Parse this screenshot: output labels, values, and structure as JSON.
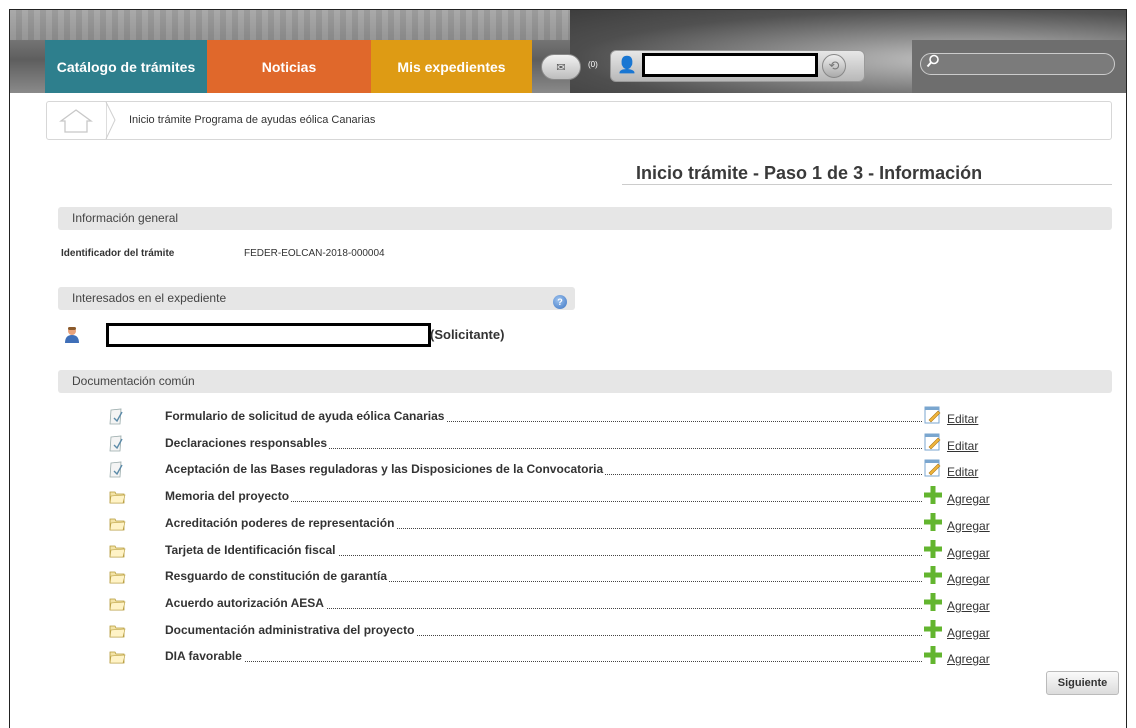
{
  "nav": {
    "tabs": [
      {
        "label": "Catálogo de trámites",
        "color": "#2e7f8d"
      },
      {
        "label": "Noticias",
        "color": "#e0682b"
      },
      {
        "label": "Mis expedientes",
        "color": "#de9b14"
      }
    ],
    "messages_count": "(0)",
    "search_placeholder": ""
  },
  "breadcrumb": {
    "current": "Inicio trámite Programa de ayudas eólica Canarias"
  },
  "page_title": "Inicio trámite - Paso 1 de 3 - Información",
  "general_info": {
    "section_title": "Información general",
    "id_label": "Identificador del trámite",
    "id_value": "FEDER-EOLCAN-2018-000004"
  },
  "interested": {
    "section_title": "Interesados en el expediente",
    "role": "(Solicitante)"
  },
  "documents": {
    "section_title": "Documentación común",
    "items": [
      {
        "name": "Formulario de solicitud de ayuda eólica Canarias",
        "action": "Editar",
        "icon": "form-icon",
        "action_icon": "edit-icon"
      },
      {
        "name": "Declaraciones responsables",
        "action": "Editar",
        "icon": "form-icon",
        "action_icon": "edit-icon"
      },
      {
        "name": "Aceptación de las Bases reguladoras y las Disposiciones de la Convocatoria",
        "action": "Editar",
        "icon": "form-icon",
        "action_icon": "edit-icon"
      },
      {
        "name": "Memoria del proyecto",
        "action": "Agregar",
        "icon": "folder-icon",
        "action_icon": "add-icon"
      },
      {
        "name": "Acreditación poderes de representación",
        "action": "Agregar",
        "icon": "folder-icon",
        "action_icon": "add-icon"
      },
      {
        "name": "Tarjeta de Identificación fiscal",
        "action": "Agregar",
        "icon": "folder-icon",
        "action_icon": "add-icon"
      },
      {
        "name": "Resguardo de constitución de garantía",
        "action": "Agregar",
        "icon": "folder-icon",
        "action_icon": "add-icon"
      },
      {
        "name": "Acuerdo autorización AESA",
        "action": "Agregar",
        "icon": "folder-icon",
        "action_icon": "add-icon"
      },
      {
        "name": "Documentación administrativa del proyecto",
        "action": "Agregar",
        "icon": "folder-icon",
        "action_icon": "add-icon"
      },
      {
        "name": "DIA favorable",
        "action": "Agregar",
        "icon": "folder-icon",
        "action_icon": "add-icon"
      }
    ]
  },
  "next_button": "Siguiente"
}
